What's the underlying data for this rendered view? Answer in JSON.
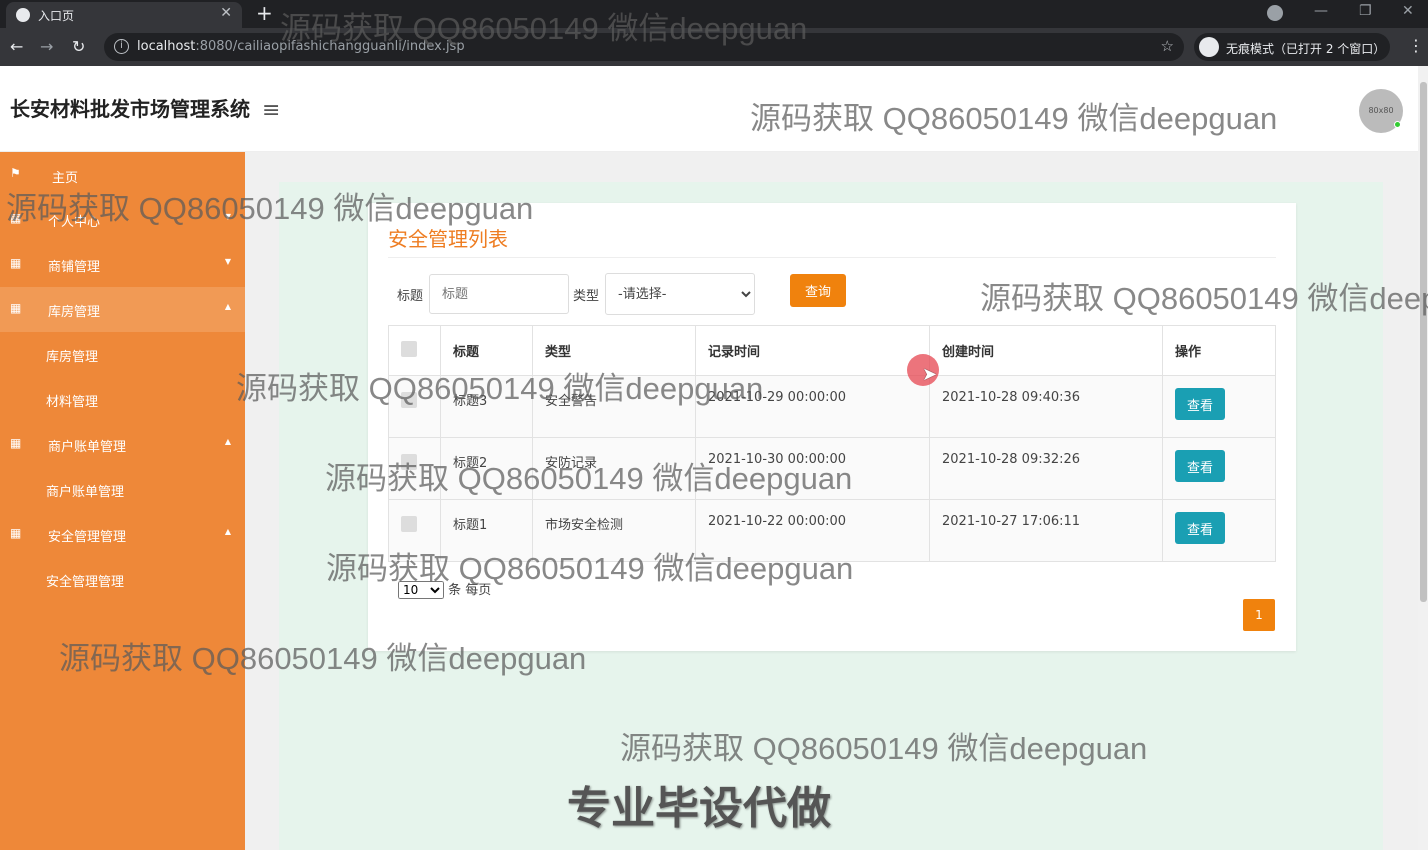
{
  "browser": {
    "tab_title": "入口页",
    "tab_close": "✕",
    "new_tab": "+",
    "url_host": "localhost",
    "url_rest": ":8080/cailiaopifashichangguanli/index.jsp",
    "incognito_text": "无痕模式（已打开 2 个窗口）",
    "window_minimize": "—",
    "window_restore": "❐",
    "window_close": "✕"
  },
  "header": {
    "app_title": "长安材料批发市场管理系统",
    "avatar_text": "80x80"
  },
  "sidebar": {
    "items": [
      {
        "label": "主页",
        "icon": "flag-icon",
        "caret": ""
      },
      {
        "label": "个人中心",
        "icon": "grid-icon",
        "caret": "▼"
      },
      {
        "label": "商铺管理",
        "icon": "grid-icon",
        "caret": "▼"
      },
      {
        "label": "库房管理",
        "icon": "grid-icon",
        "caret": "▲"
      },
      {
        "label": "商户账单管理",
        "icon": "grid-icon",
        "caret": "▲"
      },
      {
        "label": "安全管理管理",
        "icon": "grid-icon",
        "caret": "▲"
      }
    ],
    "subitems": {
      "warehouse": [
        "库房管理",
        "材料管理"
      ],
      "billing": [
        "商户账单管理"
      ],
      "safety": [
        "安全管理管理"
      ]
    }
  },
  "main": {
    "title": "安全管理列表",
    "search": {
      "title_label": "标题",
      "title_placeholder": "标题",
      "type_label": "类型",
      "type_selected": "-请选择-",
      "query_button": "查询"
    },
    "table": {
      "headers": [
        "标题",
        "类型",
        "记录时间",
        "创建时间",
        "操作"
      ],
      "rows": [
        {
          "title": "标题3",
          "type": "安全警告",
          "record_time": "2021-10-29 00:00:00",
          "create_time": "2021-10-28 09:40:36",
          "action": "查看"
        },
        {
          "title": "标题2",
          "type": "安防记录",
          "record_time": "2021-10-30 00:00:00",
          "create_time": "2021-10-28 09:32:26",
          "action": "查看"
        },
        {
          "title": "标题1",
          "type": "市场安全检测",
          "record_time": "2021-10-22 00:00:00",
          "create_time": "2021-10-27 17:06:11",
          "action": "查看"
        }
      ]
    },
    "pager": {
      "page_size": "10",
      "page_size_suffix": "条 每页",
      "current_page": "1"
    }
  },
  "watermarks": {
    "text": "源码获取 QQ86050149 微信deepguan",
    "banner": "专业毕设代做"
  },
  "colors": {
    "sidebar": "#ee8839",
    "accent": "#f0820d",
    "view_button": "#1a9fb3"
  }
}
